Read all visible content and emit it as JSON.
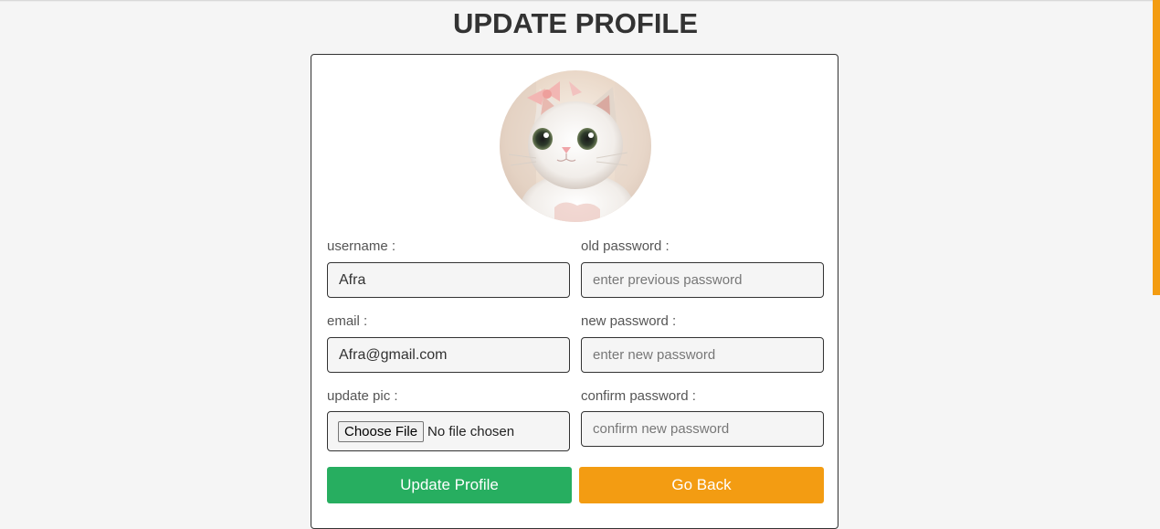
{
  "page": {
    "title": "UPDATE PROFILE"
  },
  "form": {
    "username": {
      "label": "username :",
      "value": "Afra"
    },
    "email": {
      "label": "email :",
      "value": "Afra@gmail.com"
    },
    "update_pic": {
      "label": "update pic :",
      "button": "Choose File",
      "status": "No file chosen"
    },
    "old_password": {
      "label": "old password :",
      "placeholder": "enter previous password"
    },
    "new_password": {
      "label": "new password :",
      "placeholder": "enter new password"
    },
    "confirm_password": {
      "label": "confirm password :",
      "placeholder": "confirm new password"
    }
  },
  "buttons": {
    "update": "Update Profile",
    "back": "Go Back"
  },
  "colors": {
    "update_button": "#27ae60",
    "back_button": "#f39c12",
    "scroll_thumb": "#f39c12"
  }
}
